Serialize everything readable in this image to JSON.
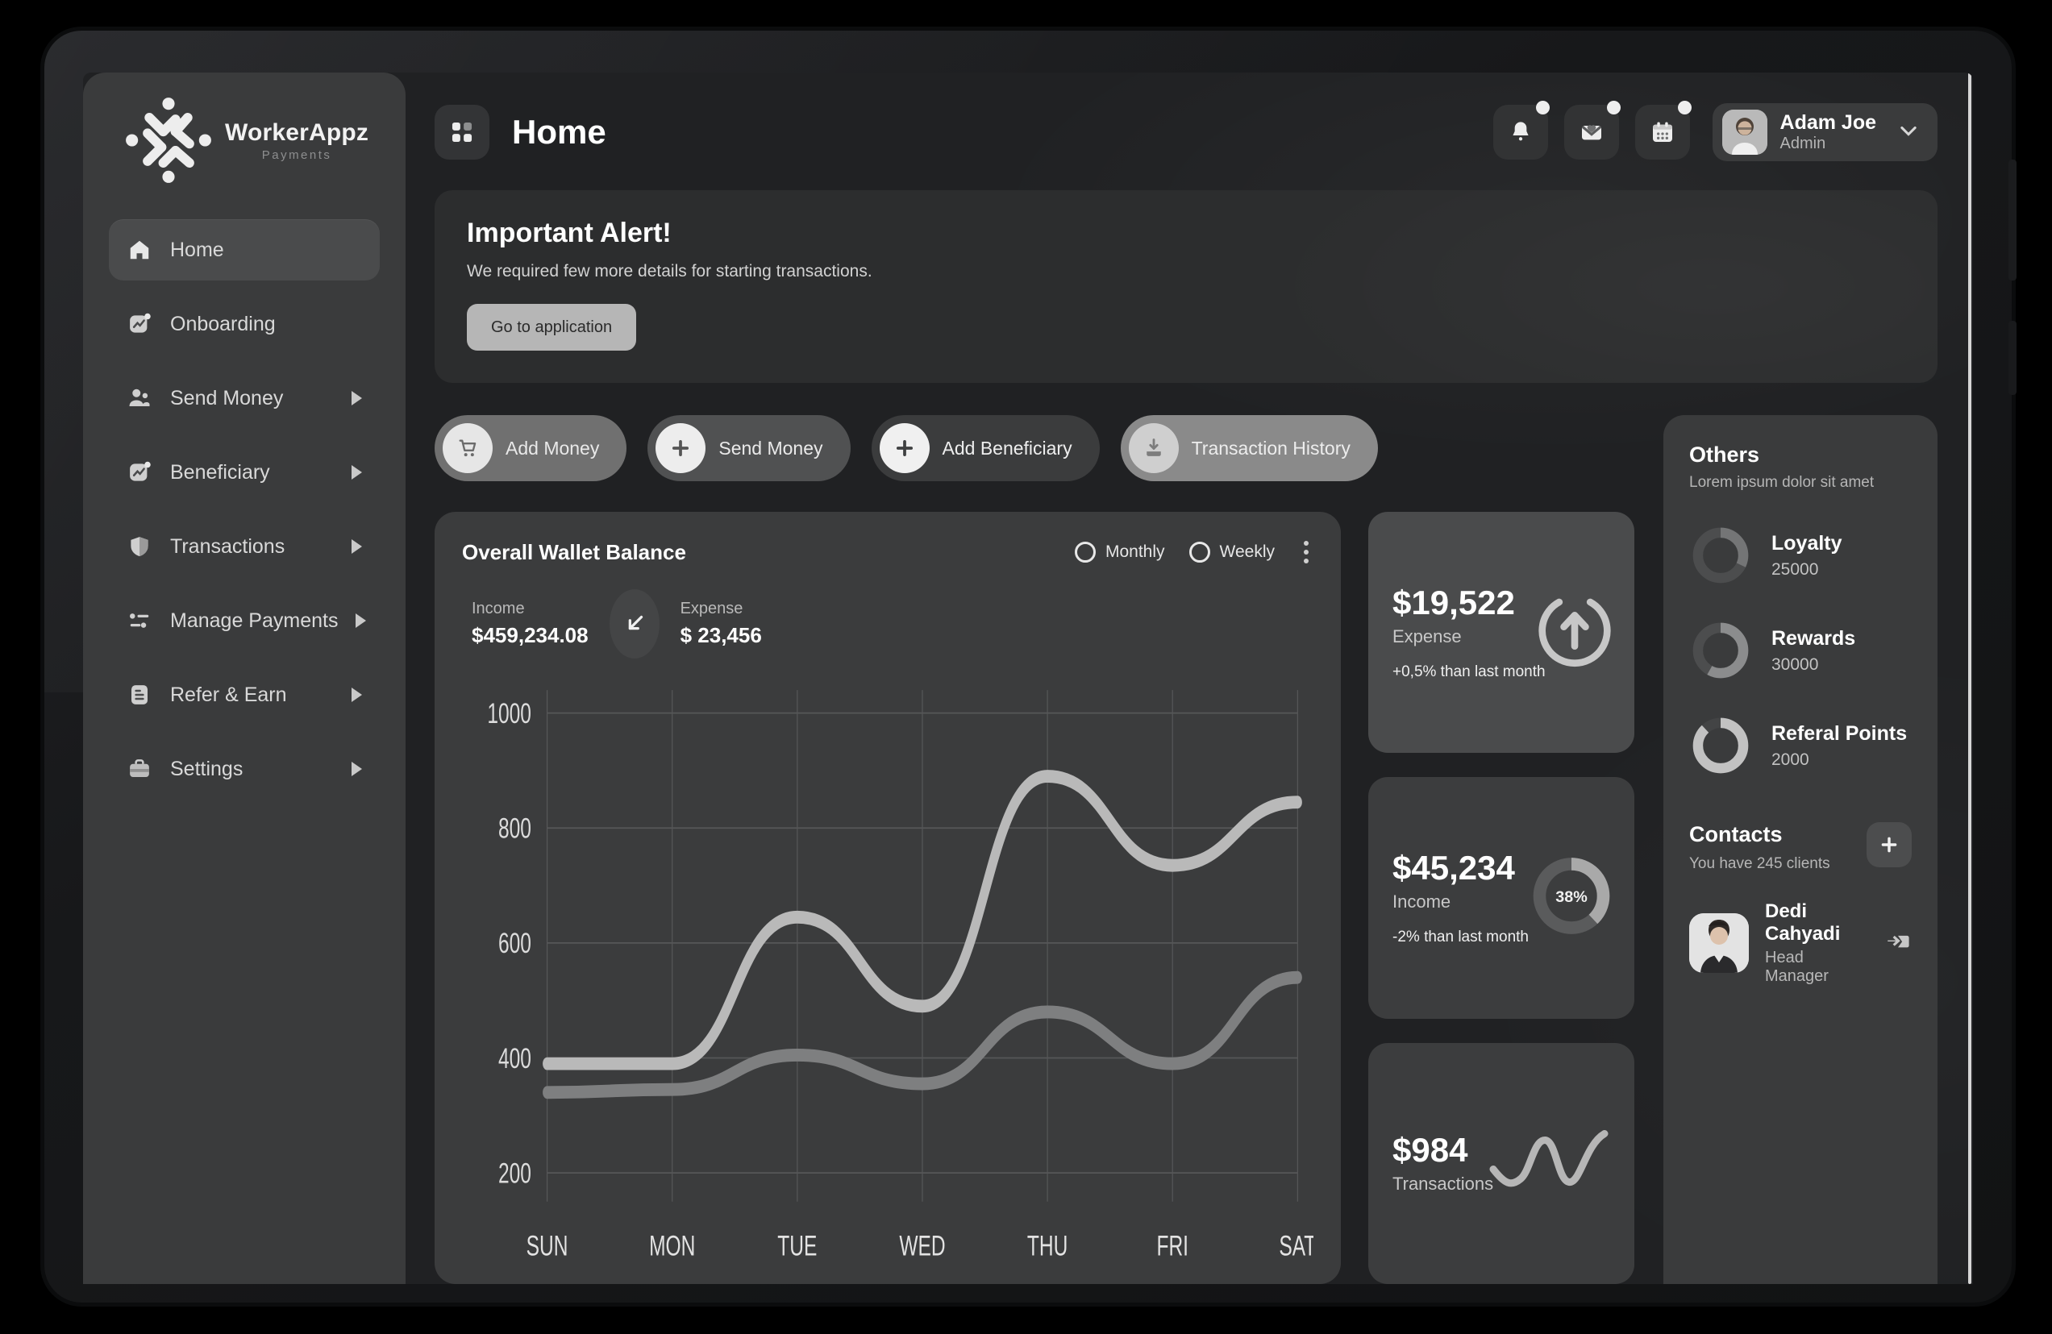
{
  "brand": {
    "name": "WorkerAppz",
    "sub": "Payments"
  },
  "sidebar": {
    "items": [
      {
        "label": "Home",
        "icon": "home-icon",
        "active": true,
        "caret": false
      },
      {
        "label": "Onboarding",
        "icon": "chart-square-icon",
        "active": false,
        "caret": false
      },
      {
        "label": "Send Money",
        "icon": "users-icon",
        "active": false,
        "caret": true
      },
      {
        "label": "Beneficiary",
        "icon": "chart-square-icon",
        "active": false,
        "caret": true
      },
      {
        "label": "Transactions",
        "icon": "shield-heart-icon",
        "active": false,
        "caret": true
      },
      {
        "label": "Manage Payments",
        "icon": "sliders-icon",
        "active": false,
        "caret": true
      },
      {
        "label": "Refer & Earn",
        "icon": "document-icon",
        "active": false,
        "caret": true
      },
      {
        "label": "Settings",
        "icon": "briefcase-icon",
        "active": false,
        "caret": true
      }
    ]
  },
  "header": {
    "title": "Home",
    "grid_icon": "grid-icon",
    "actions": [
      {
        "icon": "bell-icon",
        "has_dot": true
      },
      {
        "icon": "mail-icon",
        "has_dot": true
      },
      {
        "icon": "calendar-icon",
        "has_dot": true
      }
    ],
    "profile": {
      "name": "Adam Joe",
      "role": "Admin",
      "caret_icon": "chevron-down-icon",
      "avatar": "avatar"
    }
  },
  "alert": {
    "title": "Important Alert!",
    "description": "We required few more details for starting transactions.",
    "button_label": "Go to application"
  },
  "quick_actions": [
    {
      "label": "Add Money",
      "icon": "cart-icon"
    },
    {
      "label": "Send Money",
      "icon": "plus-icon"
    },
    {
      "label": "Add Beneficiary",
      "icon": "plus-icon"
    },
    {
      "label": "Transaction History",
      "icon": "download-icon"
    }
  ],
  "wallet": {
    "title": "Overall Wallet Balance",
    "options": [
      {
        "label": "Monthly",
        "selected": false
      },
      {
        "label": "Weekly",
        "selected": false
      }
    ],
    "menu_icon": "kebab-menu-icon",
    "income_label": "Income",
    "income_value": "$459,234.08",
    "trend_icon": "arrow-down-left-icon",
    "expense_label": "Expense",
    "expense_value": "$ 23,456"
  },
  "chart_data": {
    "type": "line",
    "title": "Overall Wallet Balance",
    "categories": [
      "SUN",
      "MON",
      "TUE",
      "WED",
      "THU",
      "FRI",
      "SAT"
    ],
    "series": [
      {
        "name": "Income",
        "values": [
          390,
          390,
          645,
          490,
          890,
          735,
          845
        ]
      },
      {
        "name": "Expense",
        "values": [
          340,
          345,
          405,
          355,
          480,
          390,
          540
        ]
      }
    ],
    "yticks": [
      200,
      400,
      600,
      800,
      1000
    ],
    "ylim": [
      150,
      1040
    ],
    "xlabel": "",
    "ylabel": "",
    "grid": true,
    "legend": "none"
  },
  "stats": [
    {
      "value": "$19,522",
      "label": "Expense",
      "delta": "+0,5% than last month",
      "gfx": "circle-arrow-up-icon",
      "highlight": true
    },
    {
      "value": "$45,234",
      "label": "Income",
      "delta": "-2% than last month",
      "gfx": "donut-38",
      "donut_pct": "38%",
      "highlight": false
    },
    {
      "value": "$984",
      "label": "Transactions",
      "delta": "",
      "gfx": "sparkline-icon",
      "highlight": false
    }
  ],
  "others": {
    "title": "Others",
    "subtitle": "Lorem ipsum dolor sit amet",
    "items": [
      {
        "name": "Loyalty",
        "value": "25000",
        "pct": 32
      },
      {
        "name": "Rewards",
        "value": "30000",
        "pct": 58
      },
      {
        "name": "Referal Points",
        "value": "2000",
        "pct": 88
      }
    ]
  },
  "contacts": {
    "title": "Contacts",
    "subtitle": "You have 245 clients",
    "add_icon": "plus-icon",
    "list": [
      {
        "name": "Dedi Cahyadi",
        "role": "Head Manager",
        "action_icon": "send-mail-icon"
      }
    ]
  }
}
